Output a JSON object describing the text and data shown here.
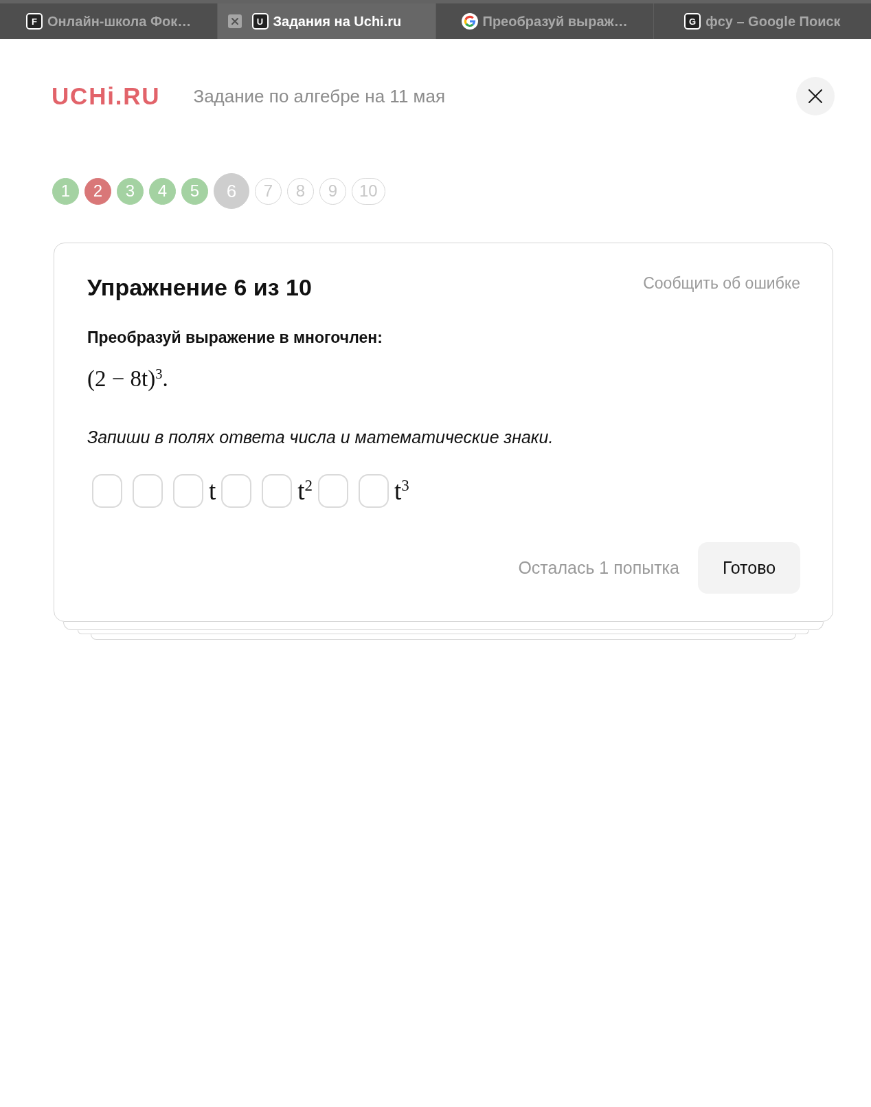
{
  "browser_tabs": [
    {
      "label": "Онлайн-школа Фок…",
      "selected": false,
      "favicon": {
        "kind": "letter",
        "letter": "F"
      }
    },
    {
      "label": "Задания на Uchi.ru",
      "selected": true,
      "favicon": {
        "kind": "letter",
        "letter": "U"
      }
    },
    {
      "label": "Преобразуй выраж…",
      "selected": false,
      "favicon": {
        "kind": "google"
      }
    },
    {
      "label": "фсу – Google Поиск",
      "selected": false,
      "favicon": {
        "kind": "letter",
        "letter": "G"
      }
    }
  ],
  "header": {
    "logo": "UCHi.RU",
    "title": "Задание по алгебре на 11 мая"
  },
  "progress": [
    {
      "number": "1",
      "visited": true,
      "selected": false,
      "color": "#a4d2a2"
    },
    {
      "number": "2",
      "visited": true,
      "selected": false,
      "color": "#d97778"
    },
    {
      "number": "3",
      "visited": true,
      "selected": false,
      "color": "#a4d2a2"
    },
    {
      "number": "4",
      "visited": true,
      "selected": false,
      "color": "#a4d2a2"
    },
    {
      "number": "5",
      "visited": true,
      "selected": false,
      "color": "#a4d2a2"
    },
    {
      "number": "6",
      "visited": true,
      "selected": true,
      "color": "#cecece"
    },
    {
      "number": "7",
      "visited": false,
      "selected": false,
      "color": "#d6d6d6"
    },
    {
      "number": "8",
      "visited": false,
      "selected": false,
      "color": "#d6d6d6"
    },
    {
      "number": "9",
      "visited": false,
      "selected": false,
      "color": "#d6d6d6"
    },
    {
      "number": "10",
      "visited": false,
      "selected": false,
      "color": "#d6d6d6"
    }
  ],
  "exercise": {
    "heading": "Упражнение 6 из 10",
    "report_link": "Сообщить об ошибке",
    "prompt": "Преобразуй выражение в многочлен:",
    "expression": "(2 − 8t)$^{3}$.",
    "instruction": "Запиши в полях ответа числа и математические знаки.",
    "answer": [
      {
        "kind": "field"
      },
      {
        "kind": "field"
      },
      {
        "kind": "field"
      },
      {
        "kind": "term",
        "text": "t"
      },
      {
        "kind": "field"
      },
      {
        "kind": "field"
      },
      {
        "kind": "term",
        "text": "t$^{2}$"
      },
      {
        "kind": "field"
      },
      {
        "kind": "field"
      },
      {
        "kind": "term",
        "text": "t$^{3}$"
      }
    ],
    "attempts_left": "Осталась 1 попытка",
    "submit_button": "Готово"
  }
}
